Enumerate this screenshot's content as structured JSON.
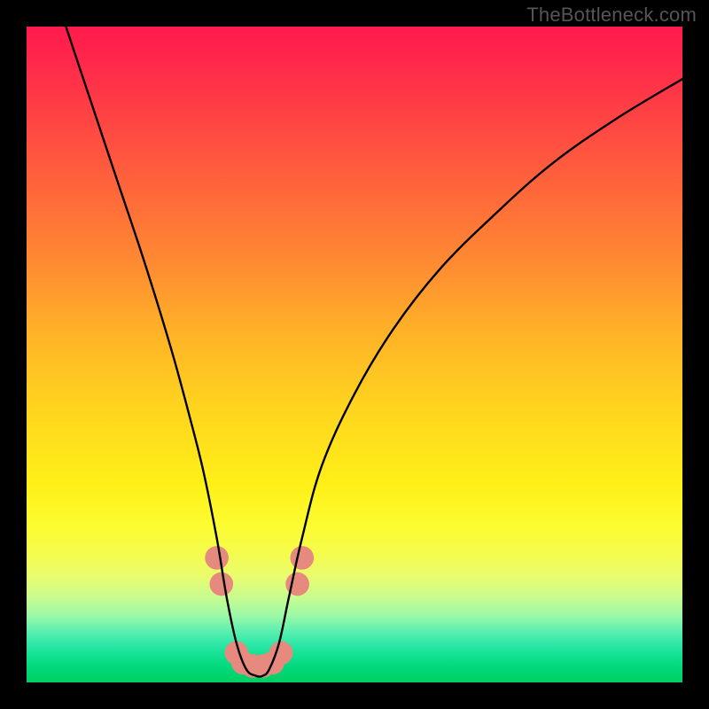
{
  "watermark": "TheBottleneck.com",
  "chart_data": {
    "type": "line",
    "title": "",
    "xlabel": "",
    "ylabel": "",
    "xlim": [
      0,
      100
    ],
    "ylim": [
      0,
      100
    ],
    "grid": false,
    "annotations": [],
    "series": [
      {
        "name": "bottleneck-curve",
        "color": "#000000",
        "x": [
          6,
          10,
          14,
          18,
          22,
          25,
          27,
          29,
          30.5,
          32,
          33.5,
          35,
          36,
          37,
          38.5,
          40,
          42,
          45,
          50,
          56,
          63,
          71,
          80,
          90,
          100
        ],
        "values": [
          100,
          88,
          76,
          64,
          51,
          40,
          32,
          22,
          13,
          6,
          2,
          1,
          1,
          2,
          6,
          13,
          22,
          33,
          44,
          54,
          63,
          71,
          79,
          86,
          92
        ]
      }
    ],
    "markers": {
      "name": "highlight-dots",
      "color": "#e6897e",
      "radius_pct": 1.8,
      "points": [
        {
          "x": 29.0,
          "y": 19
        },
        {
          "x": 29.7,
          "y": 15
        },
        {
          "x": 32.0,
          "y": 4.5
        },
        {
          "x": 33.0,
          "y": 3.0
        },
        {
          "x": 34.5,
          "y": 2.5
        },
        {
          "x": 36.0,
          "y": 2.5
        },
        {
          "x": 37.5,
          "y": 3.0
        },
        {
          "x": 38.8,
          "y": 4.5
        },
        {
          "x": 41.3,
          "y": 15
        },
        {
          "x": 42.0,
          "y": 19
        }
      ]
    },
    "background_gradient_stops": [
      {
        "pos": 0,
        "color": "#ff1a4d"
      },
      {
        "pos": 50,
        "color": "#ffc022"
      },
      {
        "pos": 75,
        "color": "#fcfc30"
      },
      {
        "pos": 100,
        "color": "#00d060"
      }
    ]
  }
}
